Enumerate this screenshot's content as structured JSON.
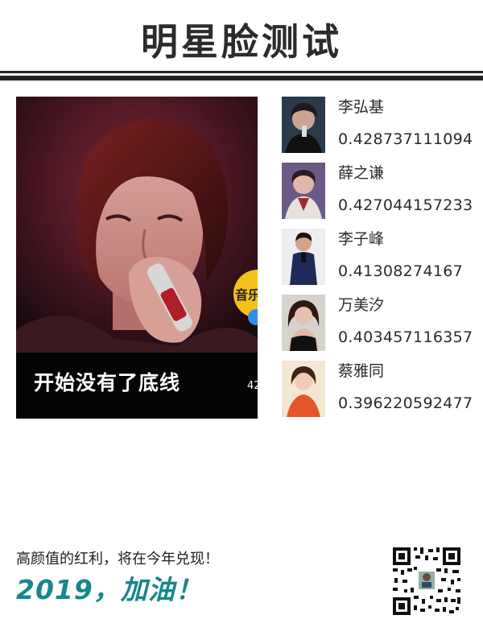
{
  "header": {
    "title": "明星脸测试"
  },
  "photo": {
    "caption": "开始没有了底线",
    "side_badge": "音乐",
    "side_count": "42"
  },
  "results": [
    {
      "name": "李弘基",
      "score": "0.428737111094"
    },
    {
      "name": "薛之谦",
      "score": "0.427044157233"
    },
    {
      "name": "李子峰",
      "score": "0.41308274167"
    },
    {
      "name": "万美汐",
      "score": "0.403457116357"
    },
    {
      "name": "蔡雅同",
      "score": "0.396220592477"
    }
  ],
  "footer": {
    "line": "高颜值的红利，将在今年兑现！",
    "slogan": "2019，加油！"
  },
  "colors": {
    "accent": "#17878b",
    "title": "#2c2c2c"
  },
  "icons": {
    "qr": "qr-code-icon"
  }
}
